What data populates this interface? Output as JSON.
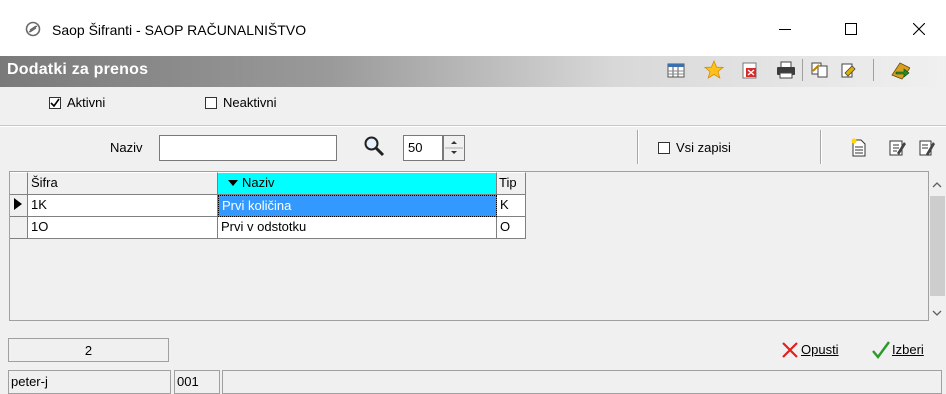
{
  "window": {
    "title": "Saop Šifranti - SAOP RAČUNALNIŠTVO",
    "icon": "saop-logo-icon",
    "controls": [
      "minimize-icon",
      "maximize-icon",
      "close-icon"
    ]
  },
  "header": {
    "title": "Dodatki za prenos",
    "toolbar_icons": [
      "columns-icon",
      "favorite-star-icon",
      "export-icon",
      "print-icon",
      "copy-icon",
      "paste-icon",
      "exit-icon"
    ]
  },
  "filters": {
    "active_label": "Aktivni",
    "active_checked": true,
    "inactive_label": "Neaktivni",
    "inactive_checked": false
  },
  "search": {
    "label": "Naziv",
    "value": "",
    "limit": "50",
    "all_records_label": "Vsi zapisi",
    "all_records_checked": false,
    "action_icons": [
      "new-record-icon",
      "edit-record-icon",
      "edit-all-icon"
    ]
  },
  "grid": {
    "columns": [
      "Šifra",
      "Naziv",
      "Tip"
    ],
    "sorted_column": "Naziv",
    "rows": [
      {
        "sifra": "1K",
        "naziv": "Prvi količina",
        "tip": "K",
        "selected": true
      },
      {
        "sifra": "1O",
        "naziv": "Prvi v odstotku",
        "tip": "O",
        "selected": false
      }
    ]
  },
  "footer": {
    "record_count": "2",
    "cancel_label": "Opusti",
    "select_label": "Izberi",
    "user": "peter-j",
    "company_code": "001",
    "status_message": ""
  },
  "colors": {
    "sort_header": "#00ffff",
    "selected_cell": "#3399ff",
    "cancel_icon": "#e02020",
    "select_icon": "#2a9a2a"
  }
}
